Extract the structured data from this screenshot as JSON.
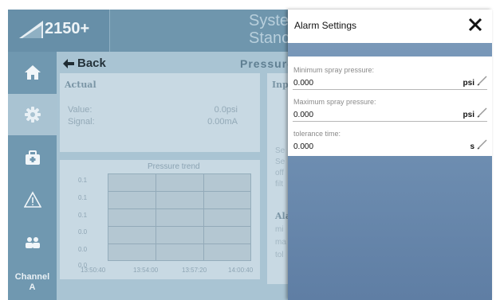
{
  "header": {
    "model": "2150+",
    "system_title_line1": "Syste",
    "system_title_line2": "Stanc"
  },
  "sidebar": {
    "items": [
      {
        "name": "home",
        "icon": "home-icon",
        "active": false
      },
      {
        "name": "settings",
        "icon": "gear-icon",
        "active": true
      },
      {
        "name": "service",
        "icon": "toolbox-icon",
        "active": false
      },
      {
        "name": "alarms",
        "icon": "warning-icon",
        "active": false
      },
      {
        "name": "users",
        "icon": "users-icon",
        "active": false
      }
    ],
    "channel_label": "Channel",
    "channel_value": "A"
  },
  "main": {
    "back_label": "Back",
    "page_title": "Pressure",
    "actual": {
      "title": "Actual",
      "value_label": "Value:",
      "value": "0.0psi",
      "signal_label": "Signal:",
      "signal": "0.00mA"
    },
    "trend": {
      "title": "Pressure trend",
      "y_ticks": [
        "0.1",
        "0.1",
        "0.1",
        "0.0",
        "0.0",
        "0.0"
      ],
      "x_ticks": [
        "13:50:40",
        "13:54:00",
        "13:57:20",
        "14:00:40"
      ]
    },
    "input_card": {
      "title": "Inp",
      "row1": "Se",
      "row2": "Se",
      "row3": "off",
      "row4": "filt"
    },
    "alarm_card": {
      "title": "Ala",
      "row1": "mi",
      "row2": "ma",
      "row3": "tol"
    }
  },
  "dialog": {
    "title": "Alarm Settings",
    "close_label": "✕",
    "fields": [
      {
        "label": "Minimum spray pressure:",
        "value": "0.000",
        "unit": "psi"
      },
      {
        "label": "Maximum spray pressure:",
        "value": "0.000",
        "unit": "psi"
      },
      {
        "label": "tolerance time:",
        "value": "0.000",
        "unit": "s"
      }
    ]
  },
  "colors": {
    "sidebar_bg": "#7098b0",
    "sidebar_active": "#a9c3d2",
    "main_bg": "#a9c4d3",
    "dialog_bg": "#6f8fb2"
  }
}
